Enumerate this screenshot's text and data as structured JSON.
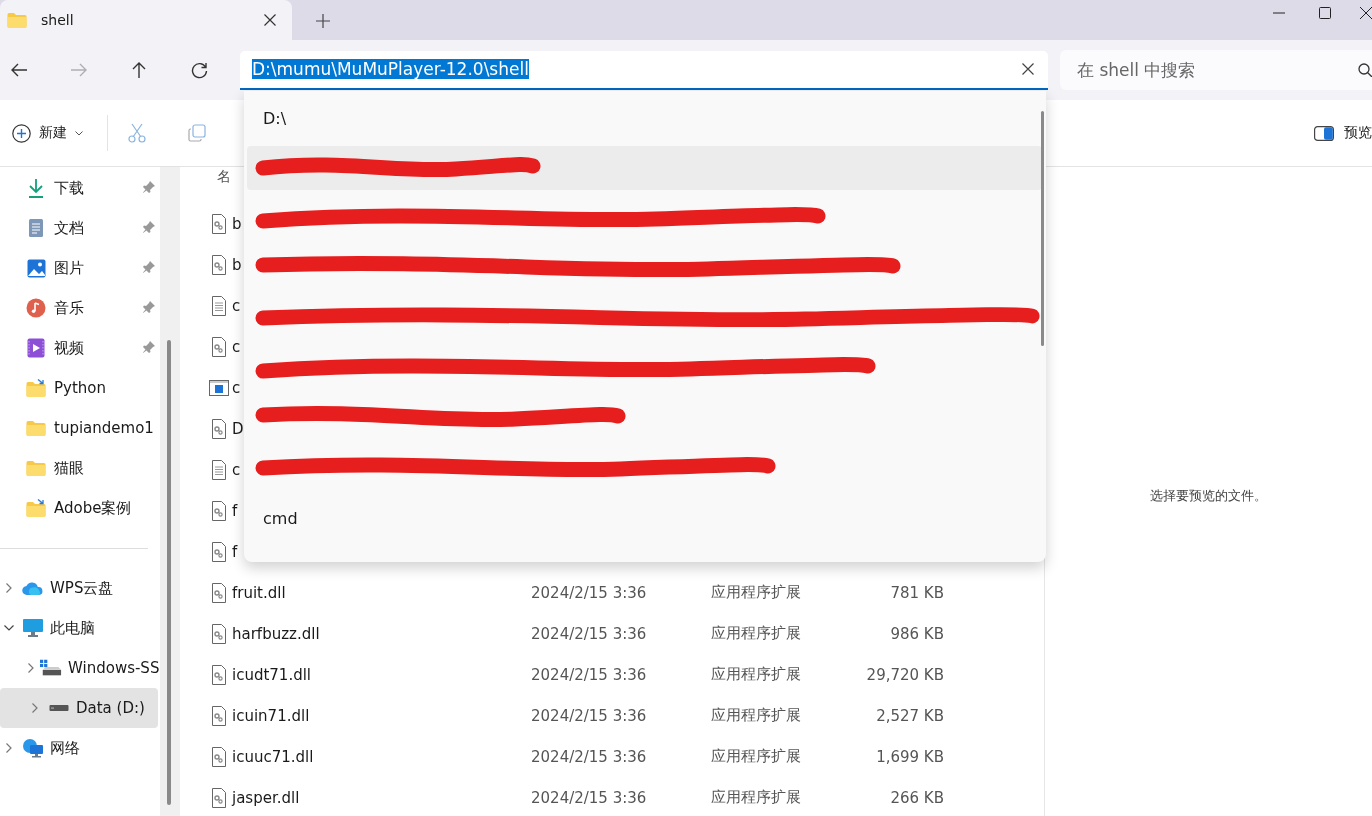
{
  "window": {
    "tab_title": "shell"
  },
  "nav": {
    "buttons": [
      {
        "kind": "back",
        "disabled": false
      },
      {
        "kind": "forward",
        "disabled": true
      },
      {
        "kind": "up",
        "disabled": false
      },
      {
        "kind": "refresh",
        "disabled": false
      }
    ],
    "address": {
      "value": "D:\\mumu\\MuMuPlayer-12.0\\shell",
      "selected": true
    },
    "search": {
      "placeholder": "在 shell 中搜索"
    }
  },
  "toolbar": {
    "new_label": "新建",
    "preview_label": "预览"
  },
  "address_suggestions": [
    {
      "kind": "path",
      "text": "D:\\",
      "selected": false
    },
    {
      "kind": "redacted",
      "selected": true
    },
    {
      "kind": "redacted",
      "selected": false
    },
    {
      "kind": "redacted",
      "selected": false
    },
    {
      "kind": "redacted",
      "selected": false
    },
    {
      "kind": "redacted",
      "selected": false
    },
    {
      "kind": "redacted",
      "selected": false
    },
    {
      "kind": "redacted",
      "selected": false
    },
    {
      "kind": "path",
      "text": "cmd",
      "selected": false
    }
  ],
  "sidebar": {
    "quick_access": [
      {
        "kind": "download",
        "label": "下载",
        "pinned": true
      },
      {
        "kind": "document",
        "label": "文档",
        "pinned": true
      },
      {
        "kind": "pictures",
        "label": "图片",
        "pinned": true
      },
      {
        "kind": "music",
        "label": "音乐",
        "pinned": true
      },
      {
        "kind": "video",
        "label": "视频",
        "pinned": true
      },
      {
        "kind": "folder-link",
        "label": "Python",
        "pinned": false
      },
      {
        "kind": "folder",
        "label": "tupiandemo1",
        "pinned": false
      },
      {
        "kind": "folder",
        "label": "猫眼",
        "pinned": false
      },
      {
        "kind": "folder-link",
        "label": "Adobe案例",
        "pinned": false
      }
    ],
    "tree": [
      {
        "kind": "cloud",
        "label": "WPS云盘",
        "expanded": false,
        "selected": false
      },
      {
        "kind": "computer",
        "label": "此电脑",
        "expanded": true,
        "selected": false,
        "children": [
          {
            "kind": "system-drive",
            "label": "Windows-SS",
            "expanded": false,
            "selected": false
          },
          {
            "kind": "drive",
            "label": "Data (D:)",
            "expanded": false,
            "selected": true
          }
        ]
      },
      {
        "kind": "network",
        "label": "网络",
        "expanded": false,
        "selected": false
      }
    ]
  },
  "file_list": {
    "columns": [
      "名"
    ],
    "rows": [
      {
        "kind": "dll",
        "name": "b"
      },
      {
        "kind": "dll",
        "name": "b"
      },
      {
        "kind": "text",
        "name": "c"
      },
      {
        "kind": "dll",
        "name": "c"
      },
      {
        "kind": "app",
        "name": "c"
      },
      {
        "kind": "dll",
        "name": "D"
      },
      {
        "kind": "text",
        "name": "c"
      },
      {
        "kind": "dll",
        "name": "f"
      },
      {
        "kind": "dll",
        "name": "f"
      },
      {
        "kind": "dll",
        "name": "fruit.dll",
        "date": "2024/2/15 3:36",
        "type": "应用程序扩展",
        "size": "781 KB"
      },
      {
        "kind": "dll",
        "name": "harfbuzz.dll",
        "date": "2024/2/15 3:36",
        "type": "应用程序扩展",
        "size": "986 KB"
      },
      {
        "kind": "dll",
        "name": "icudt71.dll",
        "date": "2024/2/15 3:36",
        "type": "应用程序扩展",
        "size": "29,720 KB"
      },
      {
        "kind": "dll",
        "name": "icuin71.dll",
        "date": "2024/2/15 3:36",
        "type": "应用程序扩展",
        "size": "2,527 KB"
      },
      {
        "kind": "dll",
        "name": "icuuc71.dll",
        "date": "2024/2/15 3:36",
        "type": "应用程序扩展",
        "size": "1,699 KB"
      },
      {
        "kind": "dll",
        "name": "jasper.dll",
        "date": "2024/2/15 3:36",
        "type": "应用程序扩展",
        "size": "266 KB"
      }
    ]
  },
  "preview_pane": {
    "message": "选择要预览的文件。"
  }
}
